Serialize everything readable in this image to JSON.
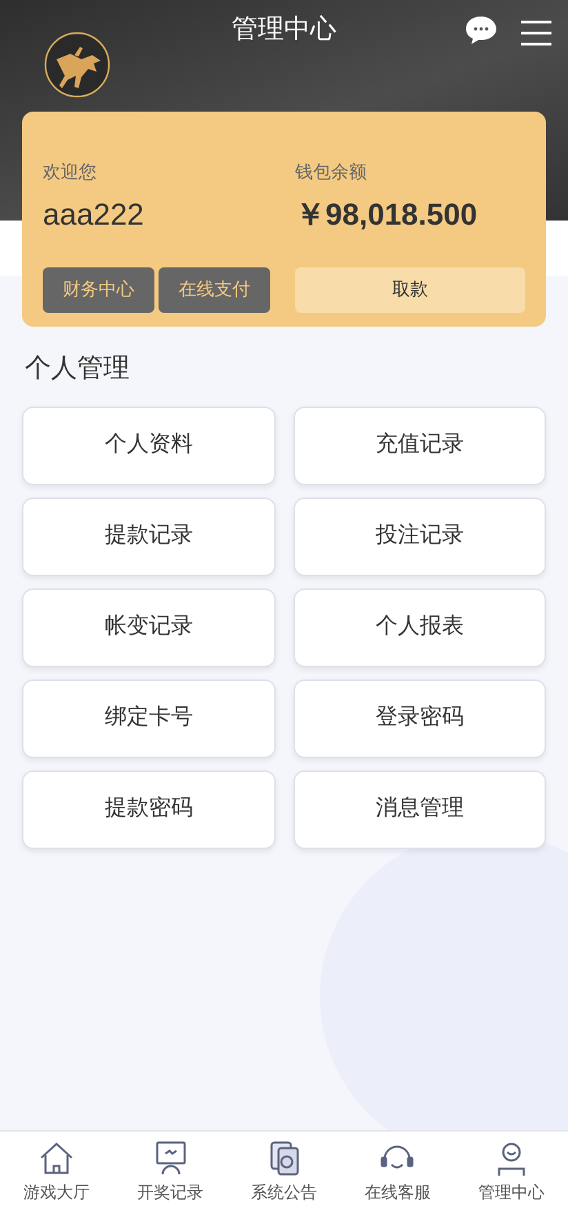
{
  "header": {
    "title": "管理中心"
  },
  "account": {
    "welcome_label": "欢迎您",
    "username": "aaa222",
    "balance_label": "钱包余额",
    "balance": "￥98,018.500",
    "buttons": [
      "财务中心",
      "在线支付"
    ],
    "withdraw_button": "取款"
  },
  "section": {
    "title": "个人管理",
    "items": [
      "个人资料",
      "充值记录",
      "提款记录",
      "投注记录",
      "帐变记录",
      "个人报表",
      "绑定卡号",
      "登录密码",
      "提款密码",
      "消息管理"
    ]
  },
  "bottom_nav": [
    {
      "kind": "home",
      "label": "游戏大厅"
    },
    {
      "kind": "monitor",
      "label": "开奖记录"
    },
    {
      "kind": "cards",
      "label": "系统公告"
    },
    {
      "kind": "headset",
      "label": "在线客服"
    },
    {
      "kind": "user",
      "label": "管理中心"
    }
  ]
}
